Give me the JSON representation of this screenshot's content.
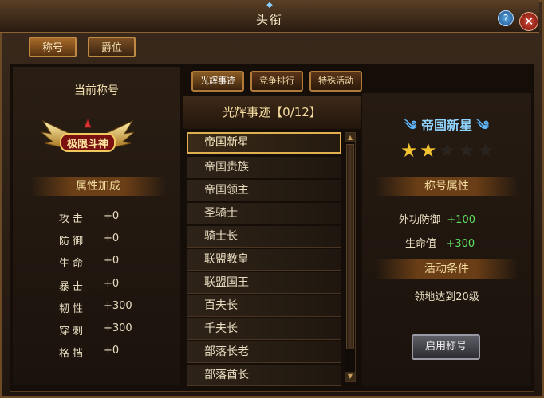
{
  "window": {
    "title": "头衔"
  },
  "top_tabs": [
    {
      "label": "称号",
      "active": true
    },
    {
      "label": "爵位",
      "active": false
    }
  ],
  "left_panel": {
    "current_title_heading": "当前称号",
    "current_title_emblem": "极限斗神",
    "attr_heading": "属性加成",
    "attrs": [
      {
        "name": "攻击",
        "value": "+0"
      },
      {
        "name": "防御",
        "value": "+0"
      },
      {
        "name": "生命",
        "value": "+0"
      },
      {
        "name": "暴击",
        "value": "+0"
      },
      {
        "name": "韧性",
        "value": "+300"
      },
      {
        "name": "穿刺",
        "value": "+300"
      },
      {
        "name": "格挡",
        "value": "+0"
      }
    ]
  },
  "sub_tabs": [
    {
      "label": "光辉事迹",
      "active": true
    },
    {
      "label": "竞争排行",
      "active": false
    },
    {
      "label": "特殊活动",
      "active": false
    }
  ],
  "list": {
    "header_title": "光辉事迹",
    "header_count": "【0/12】",
    "items": [
      "帝国新星",
      "帝国贵族",
      "帝国领主",
      "圣骑士",
      "骑士长",
      "联盟教皇",
      "联盟国王",
      "百夫长",
      "千夫长",
      "部落长老",
      "部落酋长"
    ],
    "selected_index": 0
  },
  "detail": {
    "title_name": "帝国新星",
    "stars_total": 5,
    "stars_filled": 2,
    "props_heading": "称号属性",
    "props": [
      {
        "name": "外功防御",
        "value": "+100"
      },
      {
        "name": "生命值",
        "value": "+300"
      }
    ],
    "condition_heading": "活动条件",
    "condition_text": "领地达到20级",
    "apply_label": "启用称号"
  },
  "colors": {
    "gold": "#e0b050",
    "value_green": "#5fe05f",
    "title_blue": "#8fd4ff",
    "star_gold": "#f2c230"
  }
}
